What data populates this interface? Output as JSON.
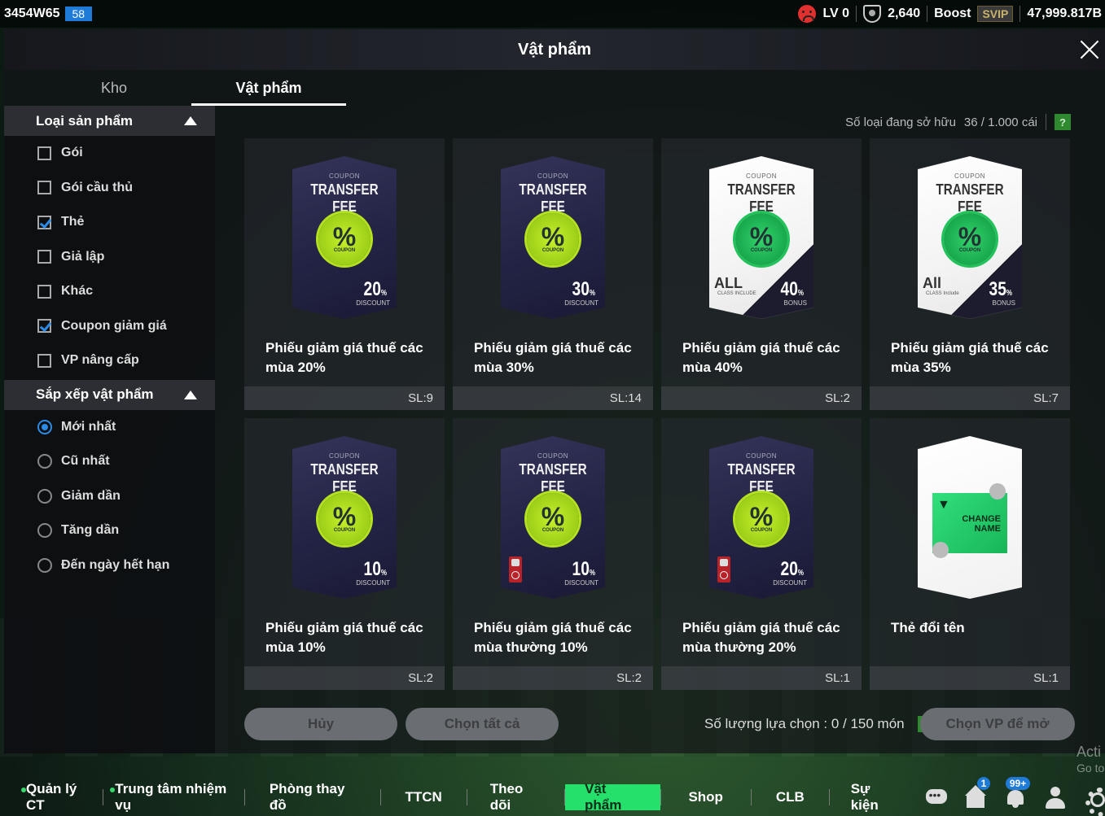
{
  "topbar": {
    "user_id": "3454W65",
    "user_level": "58",
    "lv": "LV 0",
    "trophies": "2,640",
    "boost": "Boost",
    "svip": "SVIP",
    "currency": "47,999.817B"
  },
  "panel": {
    "title": "Vật phẩm",
    "tabs": [
      {
        "label": "Kho"
      },
      {
        "label": "Vật phẩm"
      }
    ]
  },
  "sidebar": {
    "product_type": {
      "title": "Loại sản phẩm",
      "options": [
        {
          "label": "Gói",
          "checked": false
        },
        {
          "label": "Gói cầu thủ",
          "checked": false
        },
        {
          "label": "Thẻ",
          "checked": true
        },
        {
          "label": "Giả lập",
          "checked": false
        },
        {
          "label": "Khác",
          "checked": false
        },
        {
          "label": "Coupon giảm giá",
          "checked": true
        },
        {
          "label": "VP nâng cấp",
          "checked": false
        }
      ]
    },
    "sort": {
      "title": "Sắp xếp vật phẩm",
      "options": [
        {
          "label": "Mới nhất",
          "checked": true
        },
        {
          "label": "Cũ nhất",
          "checked": false
        },
        {
          "label": "Giảm dần",
          "checked": false
        },
        {
          "label": "Tăng dần",
          "checked": false
        },
        {
          "label": "Đến ngày hết hạn",
          "checked": false
        }
      ]
    }
  },
  "owned": {
    "label": "Số loại đang sở hữu",
    "value": "36 / 1.000 cái",
    "help": "?"
  },
  "items": [
    {
      "name": "Phiếu giảm giá thuế các mùa 20%",
      "qty": "SL:9",
      "coupon_small": "COUPON",
      "coupon_title": "TRANSFER FEE",
      "badge": "%",
      "badge_sub": "COUPON",
      "value": "20",
      "value_unit": "%",
      "value_label": "DISCOUNT"
    },
    {
      "name": "Phiếu giảm giá thuế các mùa 30%",
      "qty": "SL:14",
      "coupon_small": "COUPON",
      "coupon_title": "TRANSFER FEE",
      "badge": "%",
      "badge_sub": "COUPON",
      "value": "30",
      "value_unit": "%",
      "value_label": "DISCOUNT"
    },
    {
      "name": "Phiếu giảm giá thuế các mùa 40%",
      "qty": "SL:2",
      "coupon_small": "COUPON",
      "coupon_title": "TRANSFER FEE",
      "badge": "%",
      "badge_sub": "COUPON",
      "value": "40",
      "value_unit": "%",
      "value_label": "BONUS",
      "all": "ALL",
      "all_sub": "CLASS INCLUDE"
    },
    {
      "name": "Phiếu giảm giá thuế các mùa 35%",
      "qty": "SL:7",
      "coupon_small": "COUPON",
      "coupon_title": "TRANSFER FEE",
      "badge": "%",
      "badge_sub": "COUPON",
      "value": "35",
      "value_unit": "%",
      "value_label": "BONUS",
      "all": "All",
      "all_sub": "CLASS Include"
    },
    {
      "name": "Phiếu giảm giá thuế các mùa 10%",
      "qty": "SL:2",
      "coupon_small": "COUPON",
      "coupon_title": "TRANSFER FEE",
      "badge": "%",
      "badge_sub": "COUPON",
      "value": "10",
      "value_unit": "%",
      "value_label": "DISCOUNT"
    },
    {
      "name": "Phiếu giảm giá thuế các mùa thường 10%",
      "qty": "SL:2",
      "coupon_small": "COUPON",
      "coupon_title": "TRANSFER FEE",
      "badge": "%",
      "badge_sub": "COUPON",
      "value": "10",
      "value_unit": "%",
      "value_label": "DISCOUNT"
    },
    {
      "name": "Phiếu giảm giá thuế các mùa thường 20%",
      "qty": "SL:1",
      "coupon_small": "COUPON",
      "coupon_title": "TRANSFER FEE",
      "badge": "%",
      "badge_sub": "COUPON",
      "value": "20",
      "value_unit": "%",
      "value_label": "DISCOUNT"
    },
    {
      "name": "Thẻ đổi tên",
      "qty": "SL:1",
      "rename_text_1": "CHANGE",
      "rename_text_2": "NAME"
    }
  ],
  "actions": {
    "cancel": "Hủy",
    "select_all": "Chọn tất cả",
    "selection_label": "Số lượng lựa chọn : 0 / 150 món",
    "help": "?",
    "open": "Chọn VP để mở"
  },
  "nav": {
    "items": [
      {
        "label": "Quản lý CT"
      },
      {
        "label": "Trung tâm nhiệm vụ"
      },
      {
        "label": "Phòng thay đồ"
      },
      {
        "label": "TTCN"
      },
      {
        "label": "Theo dõi"
      },
      {
        "label": "Vật phẩm"
      },
      {
        "label": "Shop"
      },
      {
        "label": "CLB"
      },
      {
        "label": "Sự kiện"
      }
    ],
    "home_badge": "1",
    "bell_badge": "99+"
  },
  "watermark": {
    "line1": "Acti",
    "line2": "Go to"
  },
  "colors": {
    "accent_green": "#25e06a",
    "check_blue": "#2b8be8",
    "level_blue": "#1f7bd8"
  }
}
